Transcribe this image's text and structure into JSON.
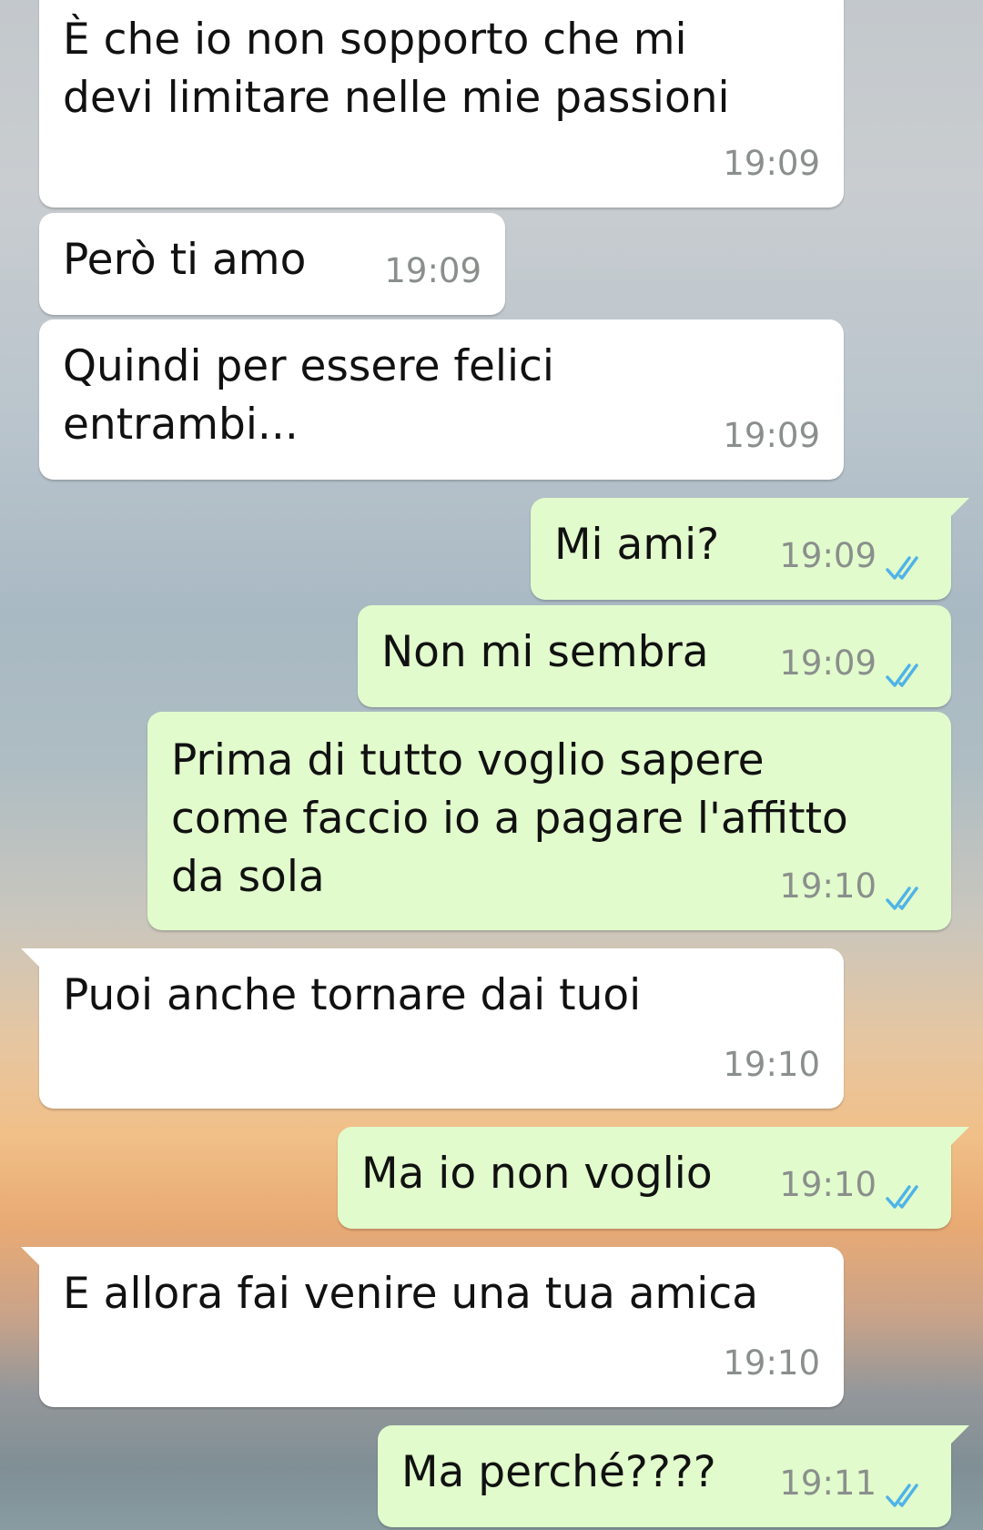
{
  "messages": [
    {
      "direction": "in",
      "text": "È che io non sopporto che mi\ndevi limitare nelle mie passioni",
      "time": "19:09"
    },
    {
      "direction": "in",
      "text": "Però ti amo",
      "time": "19:09"
    },
    {
      "direction": "in",
      "text": "Quindi per essere felici\nentrambi...",
      "time": "19:09"
    },
    {
      "direction": "out",
      "text": "Mi ami?",
      "time": "19:09",
      "status": "read"
    },
    {
      "direction": "out",
      "text": "Non mi sembra",
      "time": "19:09",
      "status": "read"
    },
    {
      "direction": "out",
      "text": "Prima di tutto voglio sapere\ncome faccio io a pagare l'affitto\nda sola",
      "time": "19:10",
      "status": "read"
    },
    {
      "direction": "in",
      "text": "Puoi anche tornare dai tuoi",
      "time": "19:10"
    },
    {
      "direction": "out",
      "text": "Ma io non voglio",
      "time": "19:10",
      "status": "read"
    },
    {
      "direction": "in",
      "text": "E allora fai venire una tua amica",
      "time": "19:10"
    },
    {
      "direction": "out",
      "text": "Ma perché????",
      "time": "19:11",
      "status": "read"
    }
  ],
  "colors": {
    "incoming_bubble": "#ffffff",
    "outgoing_bubble": "#e1fbcc",
    "read_ticks": "#4fb3e8",
    "timestamp": "#8a8f8c"
  },
  "icons": {
    "read_status": "double-check-icon"
  }
}
